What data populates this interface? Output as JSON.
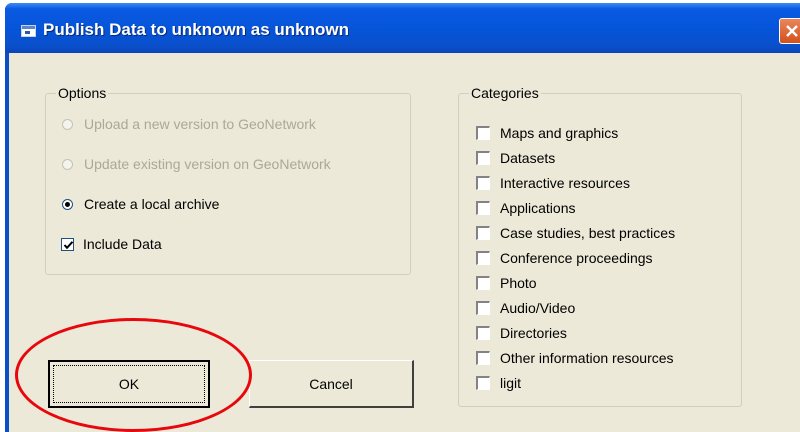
{
  "window": {
    "title": "Publish Data to unknown as unknown",
    "accent": "#0a5ae3",
    "icons": {
      "title": "window-app-icon",
      "close": "close-icon"
    }
  },
  "options": {
    "group_label": "Options",
    "radios": [
      {
        "label": "Upload a new version to GeoNetwork",
        "enabled": false,
        "selected": false
      },
      {
        "label": "Update existing version on GeoNetwork",
        "enabled": false,
        "selected": false
      },
      {
        "label": "Create a local archive",
        "enabled": true,
        "selected": true
      }
    ],
    "include_data": {
      "label": "Include Data",
      "checked": true
    }
  },
  "categories": {
    "group_label": "Categories",
    "items": [
      {
        "label": "Maps and graphics",
        "checked": false
      },
      {
        "label": "Datasets",
        "checked": false
      },
      {
        "label": "Interactive resources",
        "checked": false
      },
      {
        "label": "Applications",
        "checked": false
      },
      {
        "label": "Case studies, best practices",
        "checked": false
      },
      {
        "label": "Conference proceedings",
        "checked": false
      },
      {
        "label": "Photo",
        "checked": false
      },
      {
        "label": "Audio/Video",
        "checked": false
      },
      {
        "label": "Directories",
        "checked": false
      },
      {
        "label": "Other information resources",
        "checked": false
      },
      {
        "label": "ligit",
        "checked": false
      }
    ]
  },
  "buttons": {
    "ok": "OK",
    "cancel": "Cancel"
  },
  "annotation": {
    "color": "#e8070c"
  }
}
